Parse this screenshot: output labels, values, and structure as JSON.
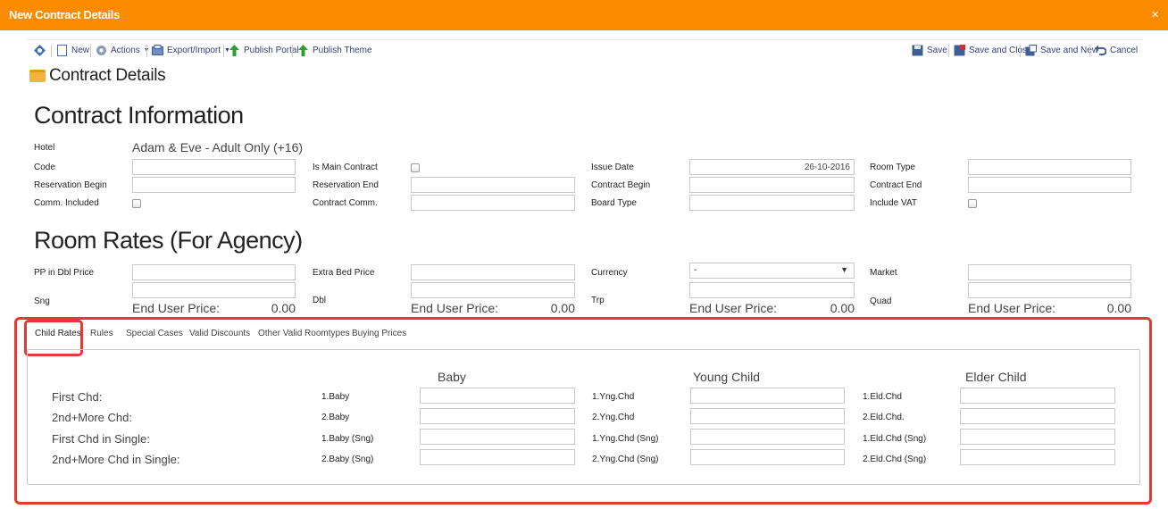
{
  "window": {
    "title": "New Contract Details",
    "close_glyph": "×"
  },
  "toolbar": {
    "new": "New",
    "actions": "Actions",
    "export_import": "Export/Import",
    "publish_portal": "Publish Portal",
    "publish_theme": "Publish Theme",
    "save": "Save",
    "save_close": "Save and Close",
    "save_new": "Save and New",
    "cancel": "Cancel"
  },
  "section_title": "Contract Details",
  "contract": {
    "heading": "Contract Information",
    "hotel_label": "Hotel",
    "hotel_value": "Adam & Eve - Adult Only (+16)",
    "code": "Code",
    "is_main": "Is Main Contract",
    "issue_date": "Issue Date",
    "issue_date_value": "26-10-2016",
    "room_type": "Room Type",
    "res_begin": "Reservation Begin",
    "res_end": "Reservation End",
    "contract_begin": "Contract Begin",
    "contract_end": "Contract End",
    "comm_included": "Comm. Included",
    "contract_comm": "Contract Comm.",
    "board_type": "Board Type",
    "include_vat": "Include VAT"
  },
  "rates": {
    "heading": "Room Rates (For Agency)",
    "pp_dbl": "PP in Dbl Price",
    "extra_bed": "Extra Bed Price",
    "currency": "Currency",
    "currency_value": "-",
    "market": "Market",
    "sng": "Sng",
    "dbl": "Dbl",
    "trp": "Trp",
    "quad": "Quad",
    "end_user_label": "End User Price:",
    "end_user_sng": "0.00",
    "end_user_dbl": "0.00",
    "end_user_trp": "0.00",
    "end_user_quad": "0.00"
  },
  "tabs": [
    "Child Rates",
    "Rules",
    "Special Cases",
    "Valid Discounts",
    "Other Valid Roomtypes",
    "Buying Prices"
  ],
  "child_rates": {
    "columns": [
      "Baby",
      "Young Child",
      "Elder Child"
    ],
    "rows": [
      {
        "label": "First Chd:",
        "baby": "1.Baby",
        "young": "1.Yng.Chd",
        "elder": "1.Eld.Chd"
      },
      {
        "label": "2nd+More Chd:",
        "baby": "2.Baby",
        "young": "2.Yng.Chd",
        "elder": "2.Eld.Chd."
      },
      {
        "label": "First Chd in Single:",
        "baby": "1.Baby (Sng)",
        "young": "1.Yng.Chd (Sng)",
        "elder": "1.Eld.Chd (Sng)"
      },
      {
        "label": "2nd+More Chd in Single:",
        "baby": "2.Baby (Sng)",
        "young": "2.Yng.Chd (Sng)",
        "elder": "2.Eld.Chd (Sng)"
      }
    ]
  }
}
